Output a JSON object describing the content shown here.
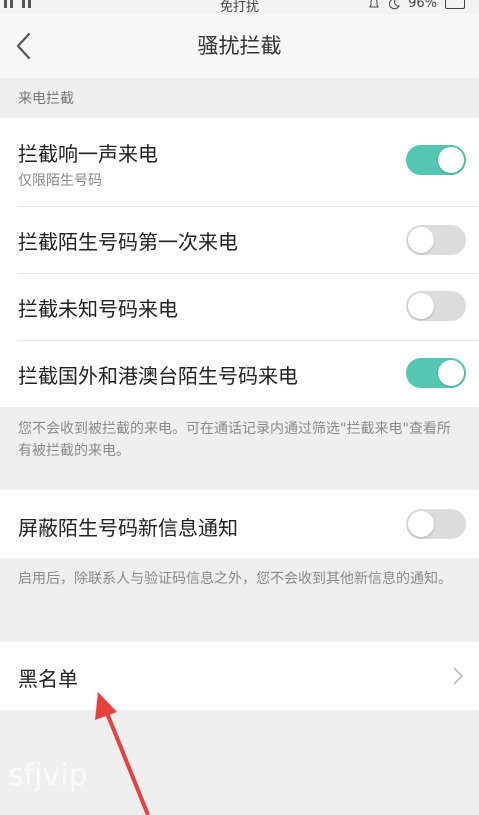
{
  "status_bar": {
    "title": "免打扰",
    "battery": "96%"
  },
  "app_bar": {
    "title": "骚扰拦截"
  },
  "call_blocking": {
    "header": "来电拦截",
    "items": [
      {
        "label": "拦截响一声来电",
        "sublabel": "仅限陌生号码",
        "enabled": true
      },
      {
        "label": "拦截陌生号码第一次来电",
        "enabled": false
      },
      {
        "label": "拦截未知号码来电",
        "enabled": false
      },
      {
        "label": "拦截国外和港澳台陌生号码来电",
        "enabled": true
      }
    ],
    "note": "您不会收到被拦截的来电。可在通话记录内通过筛选\"拦截来电\"查看所有被拦截的来电。"
  },
  "message_blocking": {
    "item": {
      "label": "屏蔽陌生号码新信息通知",
      "enabled": false
    },
    "note": "启用后，除联系人与验证码信息之外，您不会收到其他新信息的通知。"
  },
  "blacklist": {
    "label": "黑名单"
  },
  "watermark": "sfjvip",
  "colors": {
    "toggle_on": "#55c6b2",
    "toggle_off": "#dcdcdc",
    "annotation_arrow": "#e8403c"
  }
}
